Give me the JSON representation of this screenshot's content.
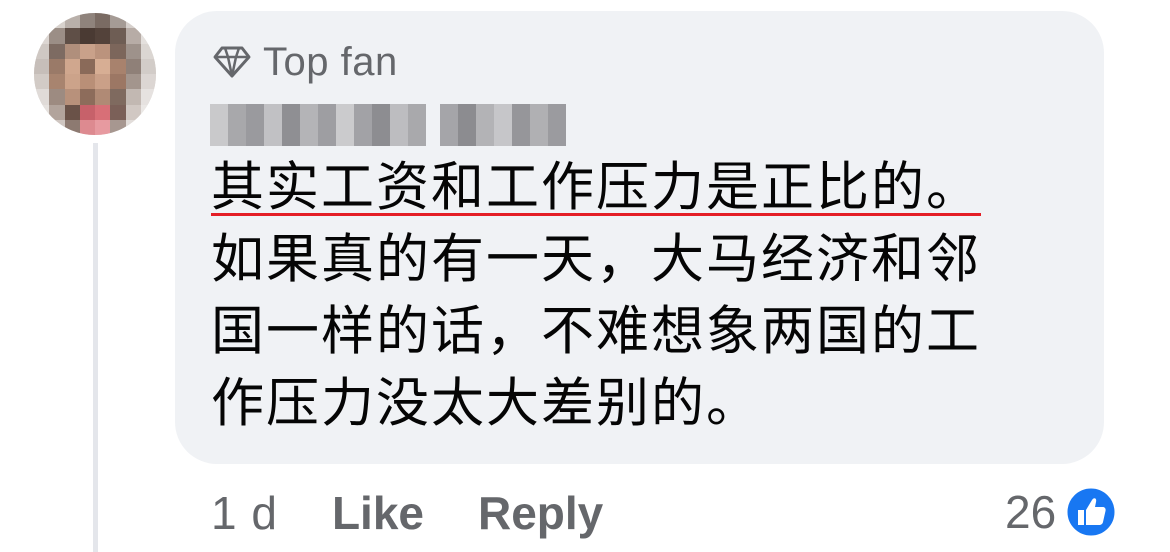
{
  "comment": {
    "badge": {
      "icon": "diamond-icon",
      "label": "Top fan"
    },
    "text_lines": [
      "其实工资和工作压力是正比的。",
      "如果真的有一天，大马经济和邻",
      "国一样的话，不难想象两国的工",
      "作压力没太大差别的。"
    ],
    "underline_color": "#e41e26"
  },
  "actions": {
    "timestamp": "1 d",
    "like_label": "Like",
    "reply_label": "Reply"
  },
  "reactions": {
    "count": "26",
    "icon": "like-reaction-icon",
    "icon_color": "#1877f2"
  },
  "colors": {
    "bubble": "#f0f2f5",
    "secondary_text": "#65676b",
    "primary_text": "#050505"
  }
}
